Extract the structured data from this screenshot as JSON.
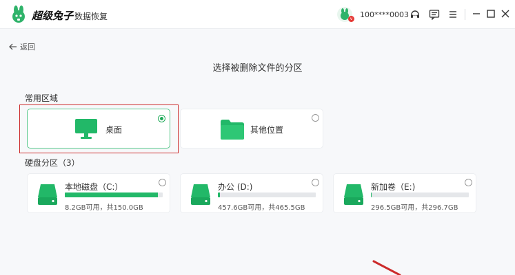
{
  "app": {
    "brand": "超级兔子",
    "subtitle": "数据恢复",
    "account": "100****0003"
  },
  "nav": {
    "back_label": "返回"
  },
  "page": {
    "title": "选择被删除文件的分区"
  },
  "common": {
    "title": "常用区域",
    "items": [
      {
        "label": "桌面",
        "selected": true,
        "icon": "monitor-icon"
      },
      {
        "label": "其他位置",
        "selected": false,
        "icon": "folder-icon"
      }
    ]
  },
  "disks": {
    "title": "硬盘分区（3）",
    "items": [
      {
        "name": "本地磁盘（C:）",
        "size": "8.2GB可用，共150.0GB",
        "used_fraction": 0.95
      },
      {
        "name": "办公 (D:)",
        "size": "457.6GB可用，共465.5GB",
        "used_fraction": 0.02
      },
      {
        "name": "新加卷（E:)",
        "size": "296.5GB可用，共296.7GB",
        "used_fraction": 0.01
      }
    ]
  },
  "colors": {
    "accent": "#1faa59",
    "bar_fill": "#22b868",
    "highlight": "#cc2b2b"
  }
}
